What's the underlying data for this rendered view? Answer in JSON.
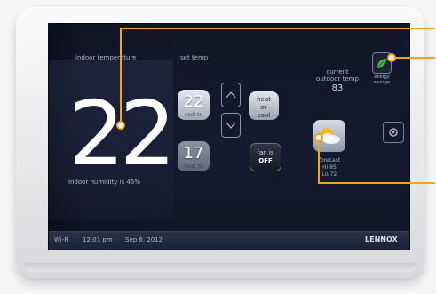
{
  "indoor": {
    "label": "indoor temperature",
    "value": "22",
    "humidity": "indoor humidity is 45%"
  },
  "setpoint": {
    "label": "set temp",
    "cool_value": "22",
    "cool_label": "cool to",
    "heat_value": "17",
    "heat_label": "heat to"
  },
  "mode": {
    "line1": "heat",
    "line2": "or",
    "line3": "cool"
  },
  "fan": {
    "line1": "fan is",
    "line2": "OFF"
  },
  "outdoor": {
    "label_line1": "current",
    "label_line2": "outdoor temp",
    "value": "83"
  },
  "forecast": {
    "label": "forecast",
    "hi": "Hi 85",
    "lo": "Lo 72"
  },
  "top_right": {
    "label_line1": "energy",
    "label_line2": "savings"
  },
  "status_bar": {
    "wifi": "Wi-Fi",
    "time": "12:01 pm",
    "date": "Sep 6, 2012",
    "brand": "LENNOX"
  },
  "colors": {
    "callout": "#f2a51a",
    "screen_bg": "#141a31",
    "leaf": "#3cbf3c"
  },
  "icons": {
    "weather": "partly-cloudy-icon",
    "leaf": "leaf-icon",
    "up": "arrow-up-icon",
    "down": "arrow-down-icon",
    "settings": "gear-icon"
  }
}
